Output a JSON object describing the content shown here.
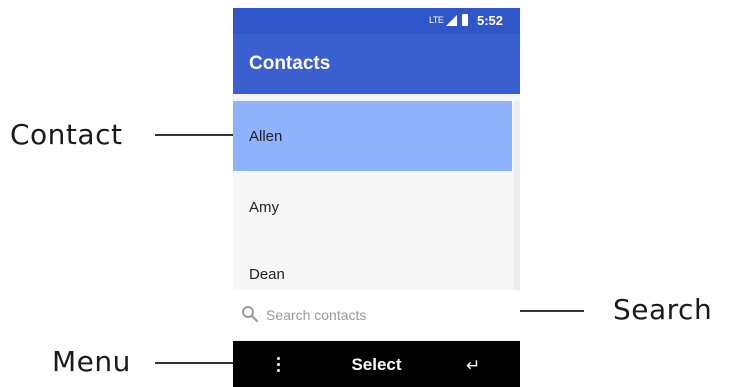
{
  "status_bar": {
    "network": "LTE",
    "time": "5:52"
  },
  "app_bar": {
    "title": "Contacts"
  },
  "contacts": [
    {
      "name": "Allen",
      "selected": true
    },
    {
      "name": "Amy",
      "selected": false
    },
    {
      "name": "Dean",
      "selected": false
    }
  ],
  "search": {
    "placeholder": "Search contacts",
    "icon": "search-icon"
  },
  "softkeys": {
    "left_icon": "menu-dots-icon",
    "center_label": "Select",
    "right_icon": "back-icon"
  },
  "callouts": {
    "contact": "Contact",
    "search": "Search",
    "menu": "Menu"
  },
  "colors": {
    "status_bar": "#2f57c9",
    "app_bar": "#3a5fcf",
    "selected_row": "#8fb2ff",
    "softkey_bar": "#000000"
  }
}
